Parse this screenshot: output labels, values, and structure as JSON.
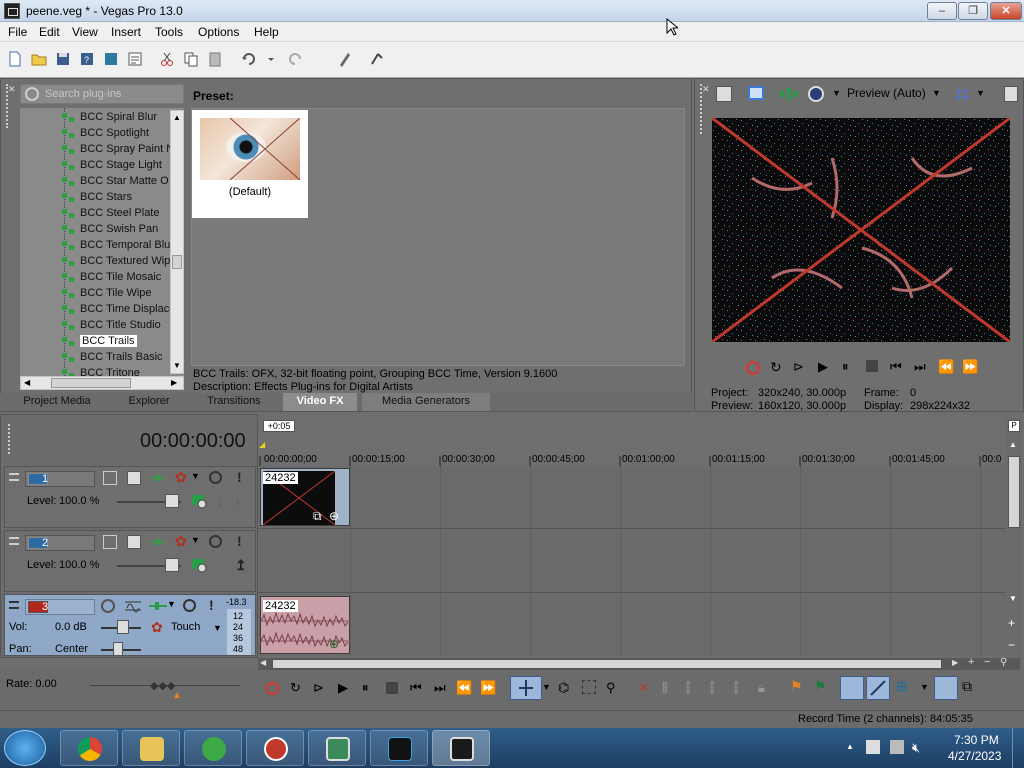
{
  "window": {
    "title": "peene.veg * - Vegas Pro 13.0",
    "controls": {
      "minimize": "–",
      "maximize": "❐",
      "close": "✕"
    }
  },
  "menu": [
    "File",
    "Edit",
    "View",
    "Insert",
    "Tools",
    "Options",
    "Help"
  ],
  "explorer": {
    "search_placeholder": "Search plug-ins",
    "items": [
      "BCC Spiral Blur",
      "BCC Spotlight",
      "BCC Spray Paint N",
      "BCC Stage Light",
      "BCC Star Matte O",
      "BCC Stars",
      "BCC Steel Plate",
      "BCC Swish Pan",
      "BCC Temporal Blur",
      "BCC Textured Wip",
      "BCC Tile Mosaic",
      "BCC Tile Wipe",
      "BCC Time Displace",
      "BCC Title Studio",
      "BCC Trails",
      "BCC Trails Basic",
      "BCC Tritone"
    ],
    "selected_item": "BCC Trails",
    "preset_label": "Preset:",
    "preset_default": "(Default)",
    "description_line1": "BCC Trails: OFX, 32-bit floating point, Grouping BCC Time, Version 9.1600",
    "description_line2": "Description: Effects Plug-ins for Digital Artists",
    "tabs": [
      "Project Media",
      "Explorer",
      "Transitions",
      "Video FX",
      "Media Generators"
    ],
    "active_tab": "Video FX"
  },
  "preview": {
    "mode": "Preview (Auto)",
    "project_label": "Project:",
    "project_value": "320x240, 30.000p",
    "preview_label": "Preview:",
    "preview_value": "160x120, 30.000p",
    "frame_label": "Frame:",
    "frame_value": "0",
    "display_label": "Display:",
    "display_value": "298x224x32"
  },
  "timeline": {
    "timecode": "00:00:00:00",
    "offset_badge": "+0:05",
    "ruler": [
      "00:00:00;00",
      "00:00:15;00",
      "00:00:30;00",
      "00:00:45;00",
      "00:01:00;00",
      "00:01:15;00",
      "00:01:30;00",
      "00:01:45;00",
      "00:0"
    ],
    "tracks": [
      {
        "number": "1",
        "level_label": "Level:",
        "level_value": "100.0 %"
      },
      {
        "number": "2",
        "level_label": "Level:",
        "level_value": "100.0 %"
      },
      {
        "number": "3",
        "vol_label": "Vol:",
        "vol_value": "0.0 dB",
        "pan_label": "Pan:",
        "pan_value": "Center",
        "touch_label": "Touch",
        "meter_top": "-18.3",
        "meter_ticks": [
          "12",
          "24",
          "36",
          "48"
        ]
      }
    ],
    "clip_video_label": "24232",
    "clip_audio_label": "24232",
    "rate_label": "Rate: 0.00"
  },
  "status": {
    "record_time": "Record Time (2 channels): 84:05:35"
  },
  "taskbar": {
    "clock_time": "7:30 PM",
    "clock_date": "4/27/2023"
  },
  "colors": {
    "panel_bg": "#6f6f6f",
    "accent_red": "#c0392b",
    "track3_bg": "#8fa8c8",
    "audio_clip": "#c9a0a8"
  }
}
